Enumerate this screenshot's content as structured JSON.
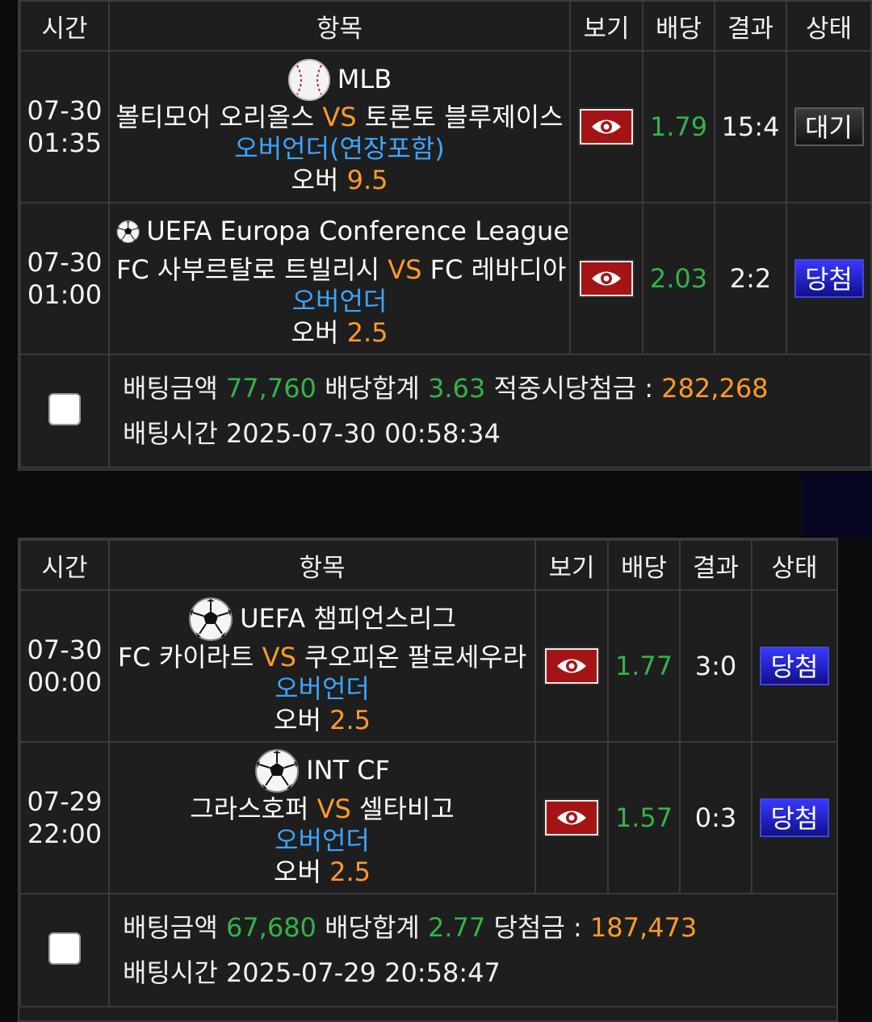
{
  "headers": {
    "time": "시간",
    "item": "항목",
    "view": "보기",
    "odds": "배당",
    "result": "결과",
    "status": "상태"
  },
  "slips": [
    {
      "bets": [
        {
          "date": "07-30",
          "time": "01:35",
          "sport_icon": "baseball-icon",
          "league": "MLB",
          "home": "볼티모어 오리올스",
          "vs": "VS",
          "away": "토론토 블루제이스",
          "market": "오버언더(연장포함)",
          "pick_label": "오버",
          "pick_line": "9.5",
          "odds": "1.79",
          "score": "15:4",
          "status": "대기"
        },
        {
          "date": "07-30",
          "time": "01:00",
          "sport_icon": "soccer-ball-icon",
          "league": "UEFA Europa Conference League",
          "home": "FC 사부르탈로 트빌리시",
          "vs": "VS",
          "away": "FC 레바디아",
          "market": "오버언더",
          "pick_label": "오버",
          "pick_line": "2.5",
          "odds": "2.03",
          "score": "2:2",
          "status": "당첨"
        }
      ],
      "summary": {
        "stake_label": "배팅금액",
        "stake": "77,760",
        "total_odds_label": "배당합계",
        "total_odds": "3.63",
        "payout_label": "적중시당첨금 :",
        "payout": "282,268",
        "time_label": "배팅시간",
        "bet_time": "2025-07-30 00:58:34"
      }
    },
    {
      "bets": [
        {
          "date": "07-30",
          "time": "00:00",
          "sport_icon": "soccer-ball-icon",
          "league": "UEFA 챔피언스리그",
          "home": "FC 카이라트",
          "vs": "VS",
          "away": "쿠오피온 팔로세우라",
          "market": "오버언더",
          "pick_label": "오버",
          "pick_line": "2.5",
          "odds": "1.77",
          "score": "3:0",
          "status": "당첨"
        },
        {
          "date": "07-29",
          "time": "22:00",
          "sport_icon": "soccer-ball-icon",
          "league": "INT CF",
          "home": "그라스호퍼",
          "vs": "VS",
          "away": "셀타비고",
          "market": "오버언더",
          "pick_label": "오버",
          "pick_line": "2.5",
          "odds": "1.57",
          "score": "0:3",
          "status": "당첨"
        }
      ],
      "summary": {
        "stake_label": "배팅금액",
        "stake": "67,680",
        "total_odds_label": "배당합계",
        "total_odds": "2.77",
        "payout_label": "당첨금 :",
        "payout": "187,473",
        "time_label": "배팅시간",
        "bet_time": "2025-07-29 20:58:47"
      }
    }
  ],
  "colors": {
    "background": "#1e1e1e",
    "border": "#3a3a3a",
    "vs": "#ff9a2a",
    "market": "#3da5ff",
    "odds": "#33b34a",
    "payout": "#ff9a2a",
    "view_button": "#a51414",
    "status_win": "#2a2ad8",
    "status_wait": "#262626"
  }
}
